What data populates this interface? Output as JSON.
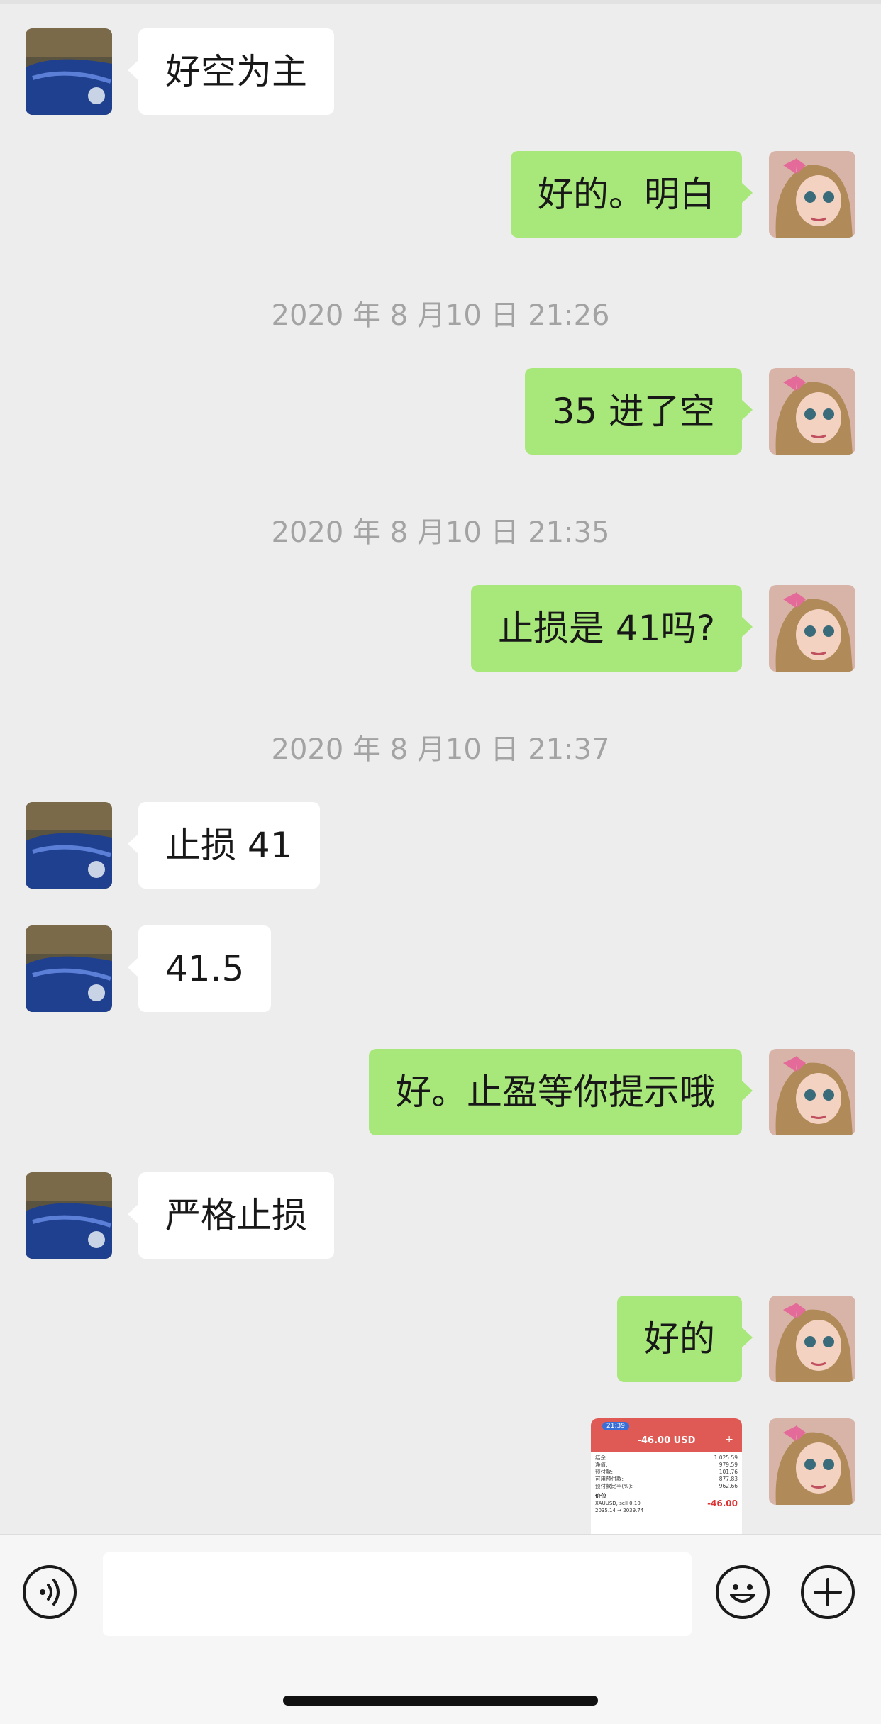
{
  "app": "WeChat",
  "messages": [
    {
      "side": "left",
      "text": "好空为主"
    },
    {
      "side": "right",
      "text": "好的。明白"
    },
    {
      "type": "time",
      "text": "2020 年 8 月10 日 21:26"
    },
    {
      "side": "right",
      "text": "35 进了空"
    },
    {
      "type": "time",
      "text": "2020 年 8 月10 日 21:35"
    },
    {
      "side": "right",
      "text": "止损是 41吗?"
    },
    {
      "type": "time",
      "text": "2020 年 8 月10 日 21:37"
    },
    {
      "side": "left",
      "text": "止损 41"
    },
    {
      "side": "left",
      "text": "41.5"
    },
    {
      "side": "right",
      "text": "好。止盈等你提示哦"
    },
    {
      "side": "left",
      "text": "严格止损"
    },
    {
      "side": "right",
      "text": "好的"
    }
  ],
  "image_message": {
    "status_time": "21:39",
    "header_amount": "-46.00 USD",
    "rows": [
      {
        "label": "结余:",
        "value": "1 025.59"
      },
      {
        "label": "净值:",
        "value": "979.59"
      },
      {
        "label": "预付款:",
        "value": "101.76"
      },
      {
        "label": "可用预付款:",
        "value": "877.83"
      },
      {
        "label": "预付款比率(%):",
        "value": "962.66"
      }
    ],
    "section": "价位",
    "position_symbol": "XAUUSD, sell 0.10",
    "position_prices": "2035.14 → 2039.74",
    "position_profit": "-46.00"
  },
  "input_bar": {
    "voice_icon": "voice-icon",
    "emoji_icon": "emoji-icon",
    "plus_icon": "plus-icon",
    "text_value": ""
  },
  "colors": {
    "background": "#ededed",
    "bubble_right": "#a8e87a",
    "bubble_left": "#ffffff",
    "time_text": "#a3a3a3"
  }
}
